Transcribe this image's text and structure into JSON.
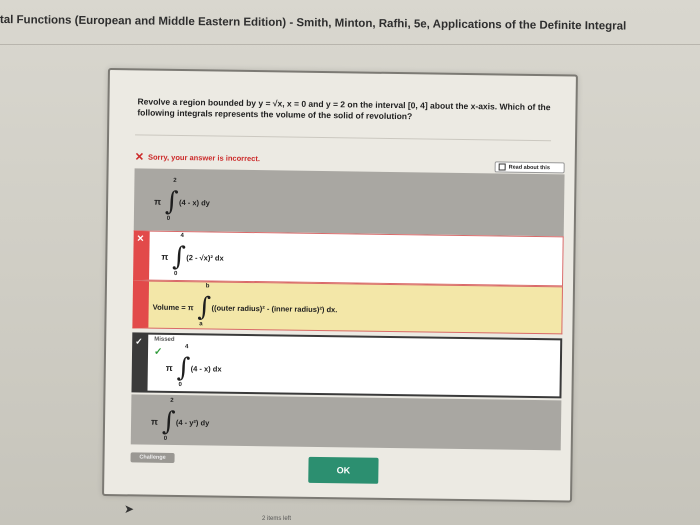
{
  "header": {
    "title": "tal Functions (European and Middle Eastern Edition) - Smith, Minton, Rafhi, 5e, Applications of the Definite Integral"
  },
  "question": {
    "text": "Revolve a region bounded by y = √x, x = 0 and y = 2 on the interval [0, 4] about the x-axis. Which of the following integrals represents the volume of the solid of revolution?"
  },
  "feedback": {
    "icon": "✕",
    "text": "Sorry, your answer is incorrect.",
    "read_about": "Read about this"
  },
  "options": [
    {
      "pi": "π",
      "upper": "2",
      "lower": "0",
      "integrand": "(4 - x) dy"
    },
    {
      "mark": "✕",
      "pi": "π",
      "upper": "4",
      "lower": "0",
      "integrand": "(2 - √x)² dx"
    },
    {
      "prefix": "Volume = π",
      "upper": "b",
      "lower": "a",
      "integrand": "((outer radius)² - (inner radius)²) dx."
    },
    {
      "mark": "✓",
      "missed": "Missed",
      "pi": "π",
      "upper": "4",
      "lower": "0",
      "integrand": "(4 - x) dx"
    },
    {
      "pi": "π",
      "upper": "2",
      "lower": "0",
      "integrand": "(4 - y²) dy"
    }
  ],
  "buttons": {
    "challenge": "Challenge",
    "ok": "OK"
  },
  "footer": {
    "items_left": "2 items left"
  },
  "colors": {
    "ok_button": "#2c8f70",
    "incorrect": "#e24a4a",
    "hint_bg": "#f3e7a8",
    "correct_check": "#2f9a3a"
  }
}
